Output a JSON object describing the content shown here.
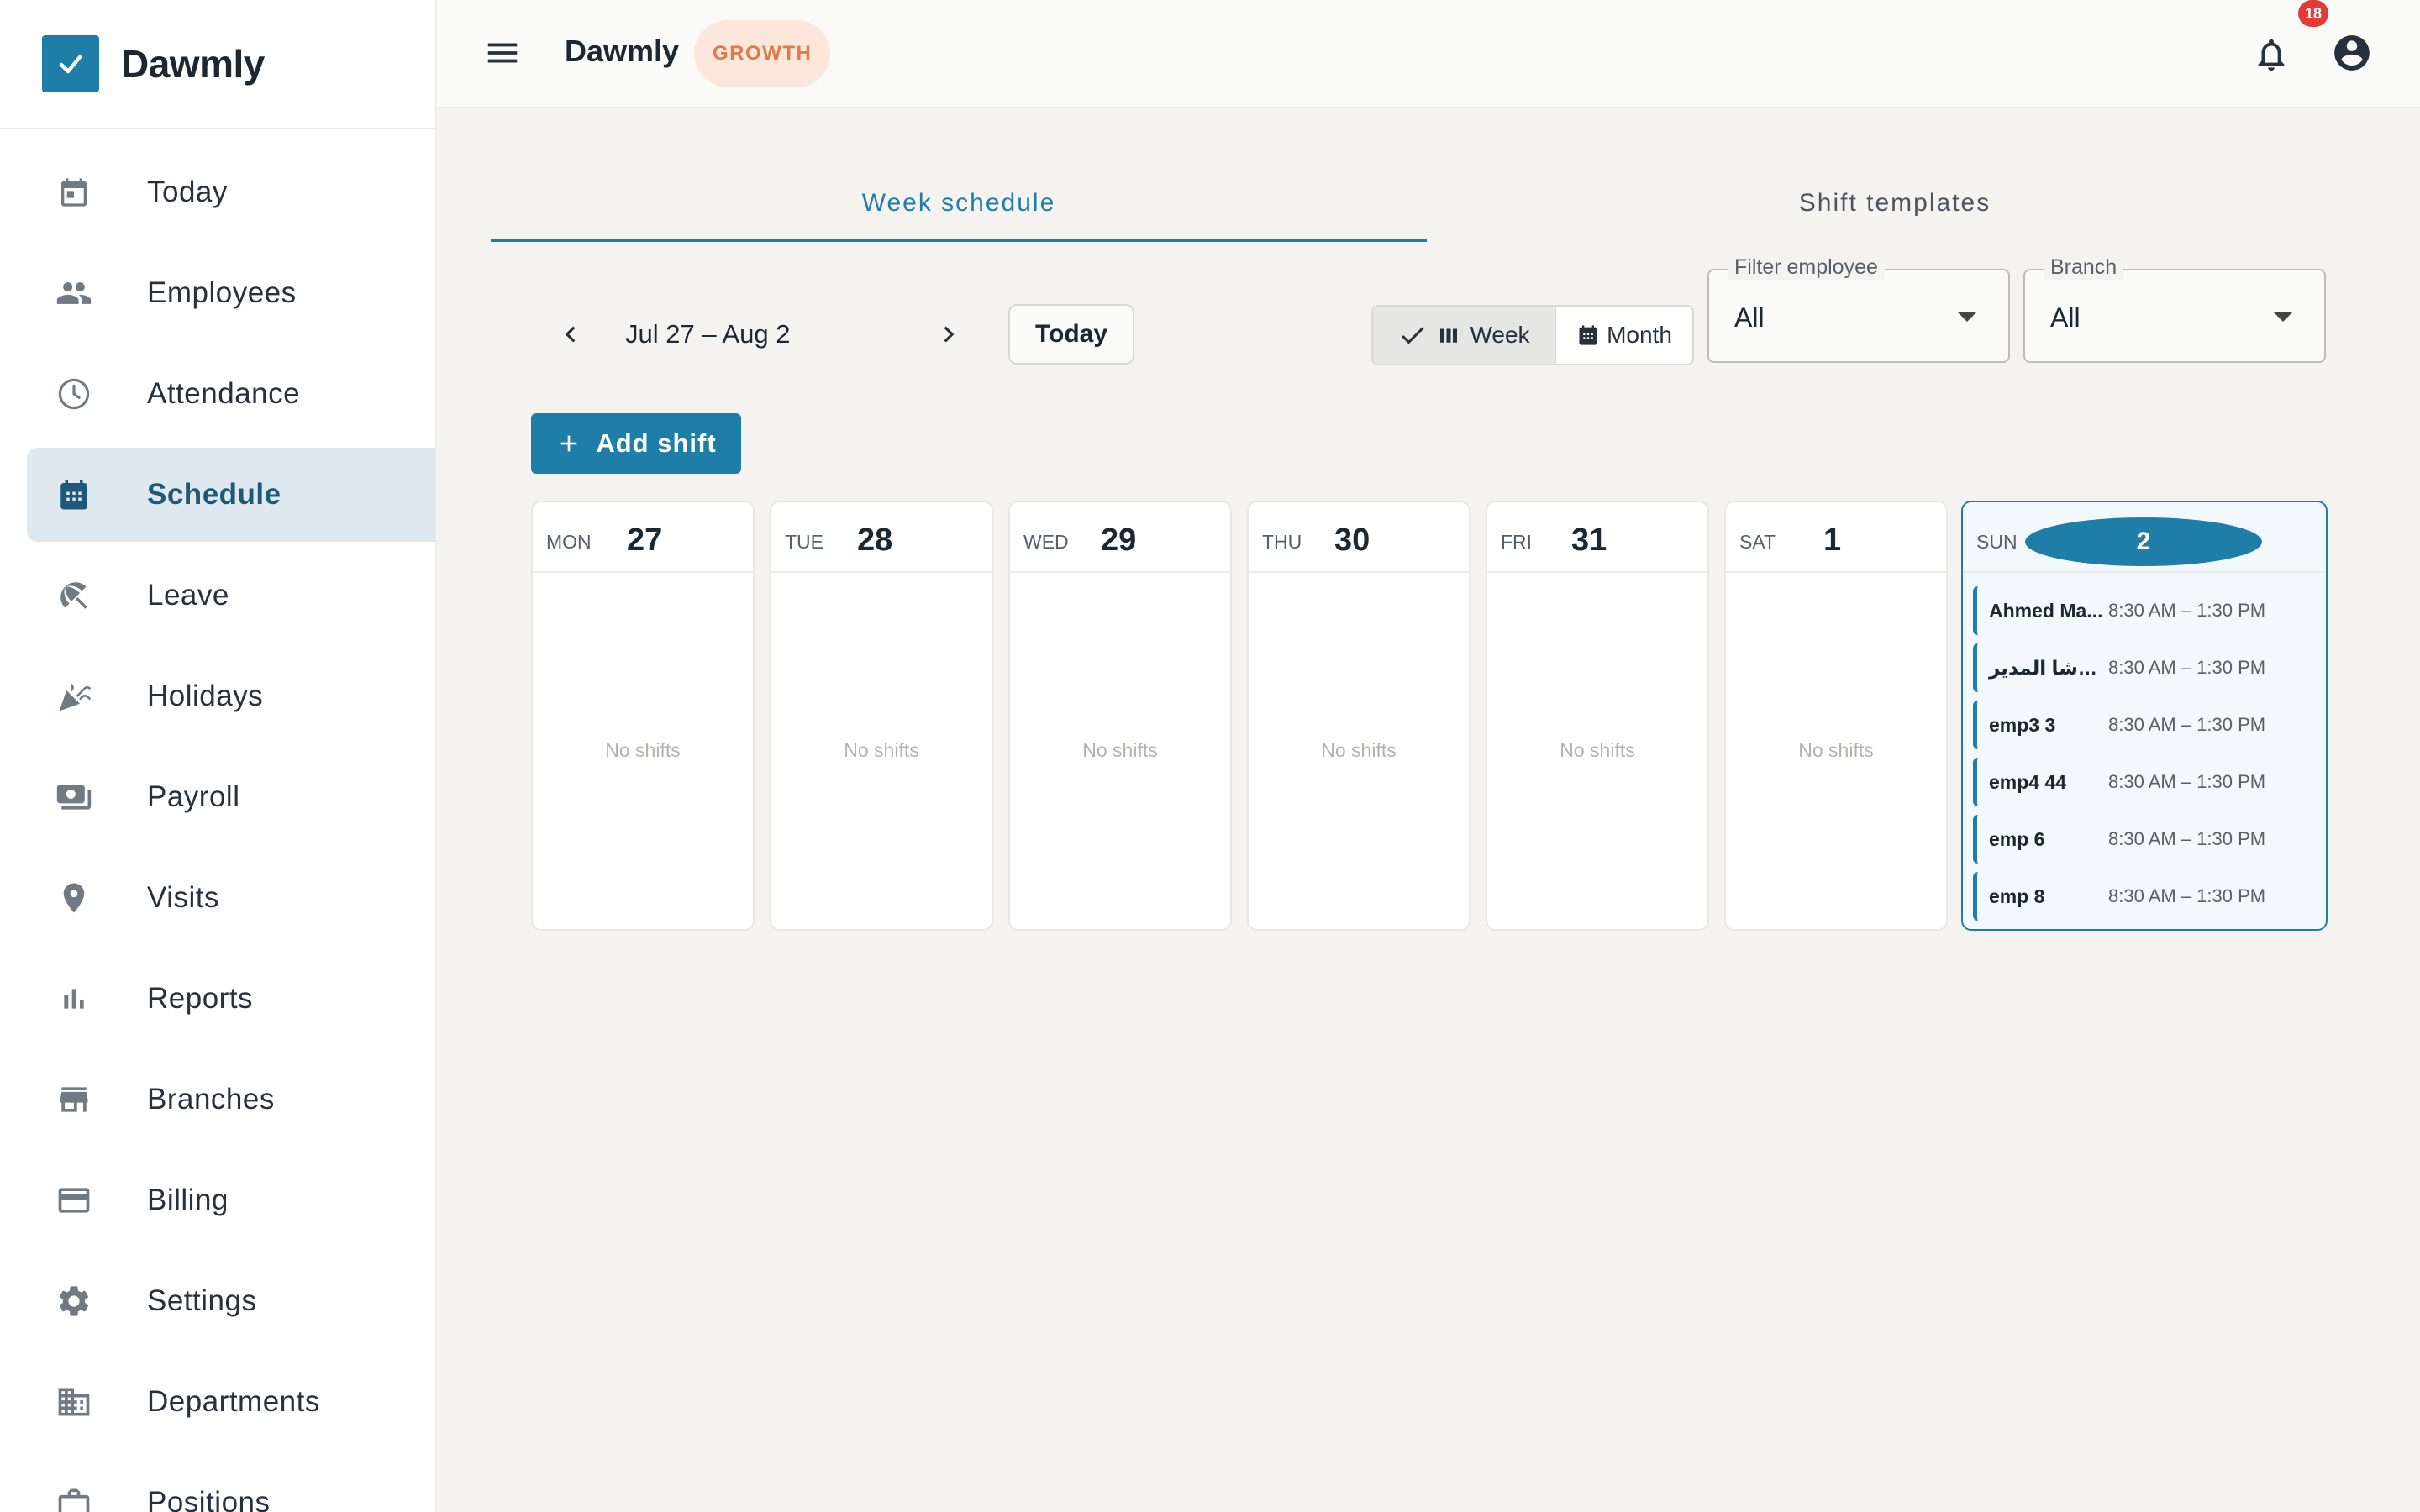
{
  "brand": {
    "name": "Dawmly"
  },
  "sidebar": {
    "items": [
      {
        "label": "Today",
        "icon": "calendar-today-icon"
      },
      {
        "label": "Employees",
        "icon": "people-icon"
      },
      {
        "label": "Attendance",
        "icon": "clock-icon"
      },
      {
        "label": "Schedule",
        "icon": "calendar-month-icon",
        "active": true
      },
      {
        "label": "Leave",
        "icon": "beach-umbrella-icon"
      },
      {
        "label": "Holidays",
        "icon": "celebration-icon"
      },
      {
        "label": "Payroll",
        "icon": "payments-icon"
      },
      {
        "label": "Visits",
        "icon": "location-pin-icon"
      },
      {
        "label": "Reports",
        "icon": "bar-chart-icon"
      },
      {
        "label": "Branches",
        "icon": "store-icon"
      },
      {
        "label": "Billing",
        "icon": "credit-card-icon"
      },
      {
        "label": "Settings",
        "icon": "gear-icon"
      },
      {
        "label": "Departments",
        "icon": "building-icon"
      },
      {
        "label": "Positions",
        "icon": "briefcase-icon"
      }
    ]
  },
  "topbar": {
    "title": "Dawmly",
    "plan": "GROWTH",
    "notifications": "18"
  },
  "tabs": [
    {
      "label": "Week schedule",
      "active": true
    },
    {
      "label": "Shift templates",
      "active": false
    }
  ],
  "controls": {
    "date_range": "Jul 27 – Aug 2",
    "today_label": "Today",
    "view_week": "Week",
    "view_month": "Month",
    "filter_employee": {
      "label": "Filter employee",
      "value": "All"
    },
    "branch": {
      "label": "Branch",
      "value": "All"
    },
    "add_shift": "Add shift"
  },
  "week": {
    "no_shifts": "No shifts",
    "days": [
      {
        "name": "MON",
        "num": "27"
      },
      {
        "name": "TUE",
        "num": "28"
      },
      {
        "name": "WED",
        "num": "29"
      },
      {
        "name": "THU",
        "num": "30"
      },
      {
        "name": "FRI",
        "num": "31"
      },
      {
        "name": "SAT",
        "num": "1"
      },
      {
        "name": "SUN",
        "num": "2",
        "today": true
      }
    ],
    "sunday_shifts": [
      {
        "employee": "Ahmed Ma...",
        "time": "8:30 AM – 1:30 PM"
      },
      {
        "employee": "الباشا المدير",
        "time": "8:30 AM – 1:30 PM"
      },
      {
        "employee": "emp3 3",
        "time": "8:30 AM – 1:30 PM"
      },
      {
        "employee": "emp4 44",
        "time": "8:30 AM – 1:30 PM"
      },
      {
        "employee": "emp 6",
        "time": "8:30 AM – 1:30 PM"
      },
      {
        "employee": "emp 8",
        "time": "8:30 AM – 1:30 PM"
      }
    ]
  },
  "colors": {
    "accent": "#1f7ea8",
    "active_nav_bg": "#dfe8ef",
    "badge_bg": "#fde6da",
    "badge_text": "#e07a4a",
    "notif": "#e53935"
  }
}
